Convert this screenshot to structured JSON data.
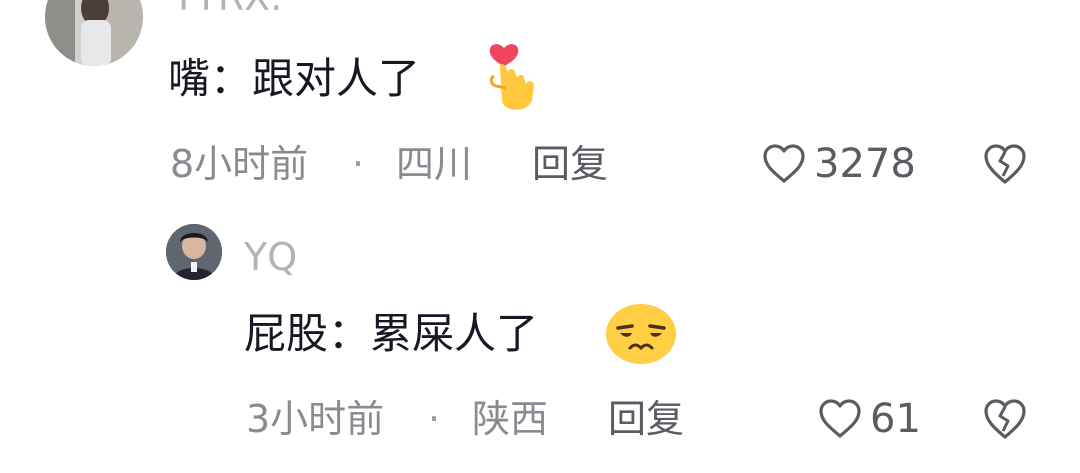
{
  "comments": [
    {
      "username": "TTRX.",
      "text": "嘴：跟对人了",
      "emoji_icon": "finger-heart-emoji",
      "time": "8小时前",
      "location": "四川",
      "reply_label": "回复",
      "likes": "3278",
      "like_icon": "heart-outline-icon",
      "dislike_icon": "broken-heart-icon"
    },
    {
      "username": "YQ",
      "text": "屁股：累屎人了",
      "emoji_icon": "smirk-face-emoji",
      "time": "3小时前",
      "location": "陕西",
      "reply_label": "回复",
      "likes": "61",
      "like_icon": "heart-outline-icon",
      "dislike_icon": "broken-heart-icon"
    }
  ],
  "separator": "·"
}
